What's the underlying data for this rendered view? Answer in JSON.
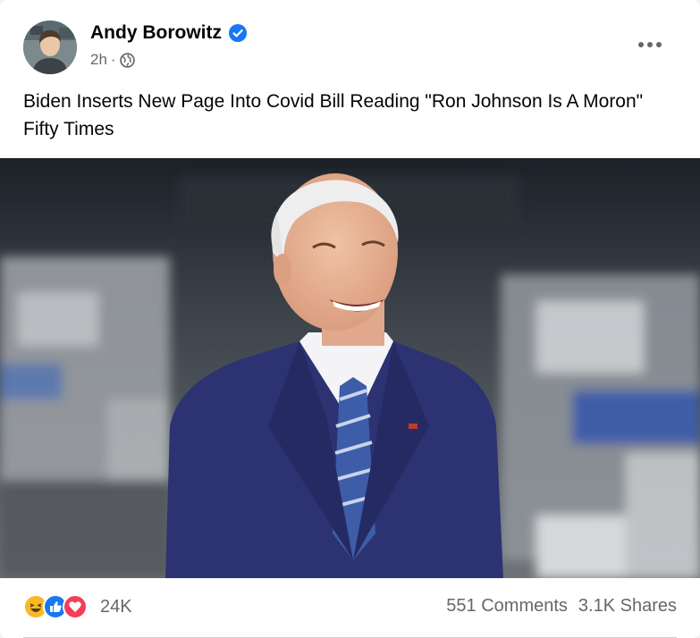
{
  "post": {
    "author": "Andy Borowitz",
    "time": "2h",
    "separator": "·",
    "privacy_icon": "globe-icon",
    "verified_icon": "verified-badge-icon",
    "more_icon": "more-options-icon",
    "caption": "Biden Inserts New Page Into Covid Bill Reading \"Ron Johnson Is A Moron\" Fifty Times"
  },
  "reactions": {
    "icons": [
      "haha-icon",
      "like-icon",
      "love-icon"
    ],
    "count": "24K"
  },
  "stats": {
    "comments": "551 Comments",
    "shares": "3.1K Shares"
  },
  "colors": {
    "verified_blue": "#1877f2",
    "like_blue": "#1877f2",
    "love_red": "#f33e58",
    "haha_yellow": "#f7b928",
    "suit_navy": "#2c3272"
  }
}
